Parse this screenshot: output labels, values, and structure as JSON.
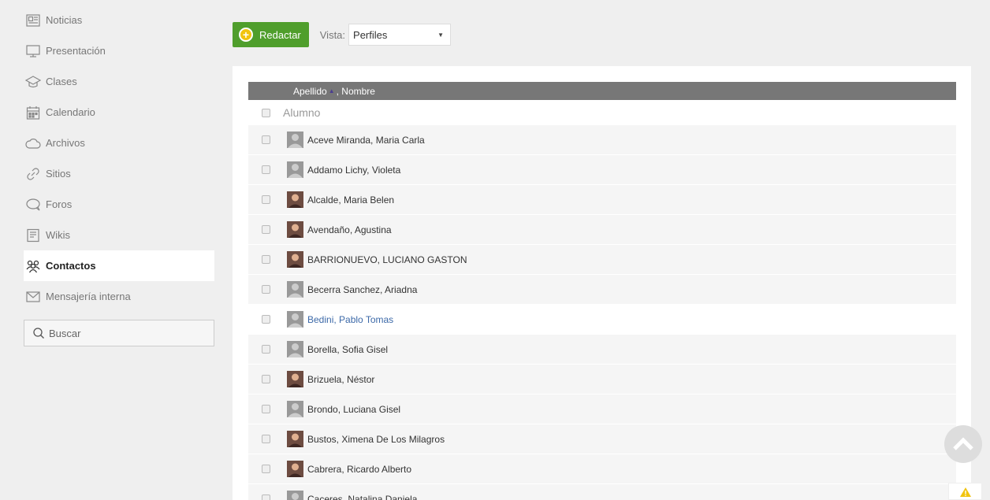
{
  "sidebar": {
    "items": [
      {
        "label": "Noticias",
        "icon": "newspaper-icon"
      },
      {
        "label": "Presentación",
        "icon": "monitor-icon"
      },
      {
        "label": "Clases",
        "icon": "graduation-cap-icon"
      },
      {
        "label": "Calendario",
        "icon": "calendar-icon"
      },
      {
        "label": "Archivos",
        "icon": "cloud-icon"
      },
      {
        "label": "Sitios",
        "icon": "link-icon"
      },
      {
        "label": "Foros",
        "icon": "chat-bubble-icon"
      },
      {
        "label": "Wikis",
        "icon": "document-icon"
      },
      {
        "label": "Contactos",
        "icon": "people-icon",
        "active": true
      },
      {
        "label": "Mensajería interna",
        "icon": "envelope-icon"
      }
    ],
    "search_label": "Buscar"
  },
  "toolbar": {
    "compose_label": "Redactar",
    "vista_label": "Vista:",
    "vista_value": "Perfiles"
  },
  "table": {
    "header_apellido": "Apellido",
    "header_nombre": ", Nombre",
    "group_label": "Alumno",
    "rows": [
      {
        "name": "Aceve Miranda, Maria Carla",
        "photo": false
      },
      {
        "name": "Addamo Lichy, Violeta",
        "photo": false
      },
      {
        "name": "Alcalde, Maria Belen",
        "photo": true
      },
      {
        "name": "Avendaño, Agustina",
        "photo": true
      },
      {
        "name": "BARRIONUEVO, LUCIANO GASTON",
        "photo": true
      },
      {
        "name": "Becerra Sanchez, Ariadna",
        "photo": false
      },
      {
        "name": "Bedini, Pablo Tomas",
        "photo": false,
        "highlight": true
      },
      {
        "name": "Borella, Sofia Gisel",
        "photo": false
      },
      {
        "name": "Brizuela, Néstor",
        "photo": true
      },
      {
        "name": "Brondo, Luciana Gisel",
        "photo": false
      },
      {
        "name": "Bustos, Ximena De Los Milagros",
        "photo": true
      },
      {
        "name": "Cabrera, Ricardo Alberto",
        "photo": true
      },
      {
        "name": "Caceres, Natalina Daniela",
        "photo": false
      }
    ]
  },
  "colors": {
    "compose_green": "#4f9e2c",
    "header_gray": "#777777",
    "link_blue": "#3c69a8"
  }
}
